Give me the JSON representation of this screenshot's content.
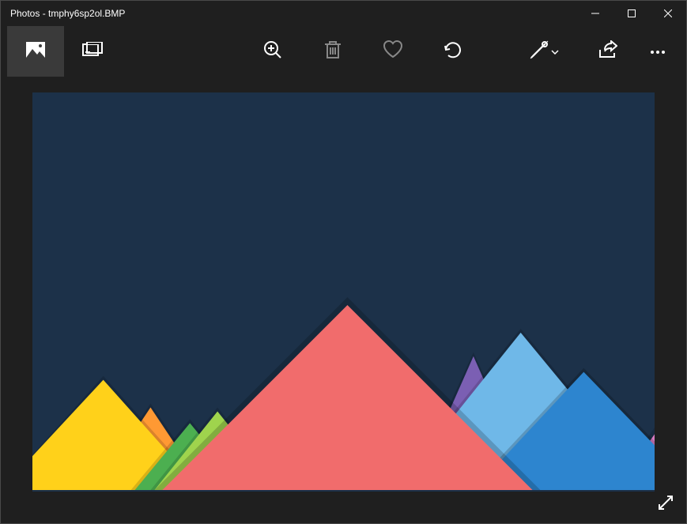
{
  "window": {
    "title": "Photos - tmphy6sp2ol.BMP"
  },
  "toolbar": {
    "viewmode_image": "Image view",
    "viewmode_compare": "Compare",
    "zoom": "Zoom",
    "delete": "Delete",
    "favorite": "Favorite",
    "rotate": "Rotate",
    "edit": "Edit & Create",
    "share": "Share",
    "more": "See more"
  },
  "controls": {
    "minimize": "Minimize",
    "maximize": "Maximize",
    "close": "Close",
    "fullscreen": "Full screen"
  },
  "image": {
    "background": "#1c3149",
    "mountains": [
      {
        "name": "yellow",
        "color": "#ffd11a"
      },
      {
        "name": "orange",
        "color": "#ff9933"
      },
      {
        "name": "lightgreen",
        "color": "#9fd44d"
      },
      {
        "name": "green",
        "color": "#4caf50"
      },
      {
        "name": "red",
        "color": "#f16c6c"
      },
      {
        "name": "purple",
        "color": "#7b5fb3"
      },
      {
        "name": "lightblue",
        "color": "#6fb8e8"
      },
      {
        "name": "blue",
        "color": "#2d85cf"
      },
      {
        "name": "pink",
        "color": "#d77bc1"
      }
    ]
  }
}
